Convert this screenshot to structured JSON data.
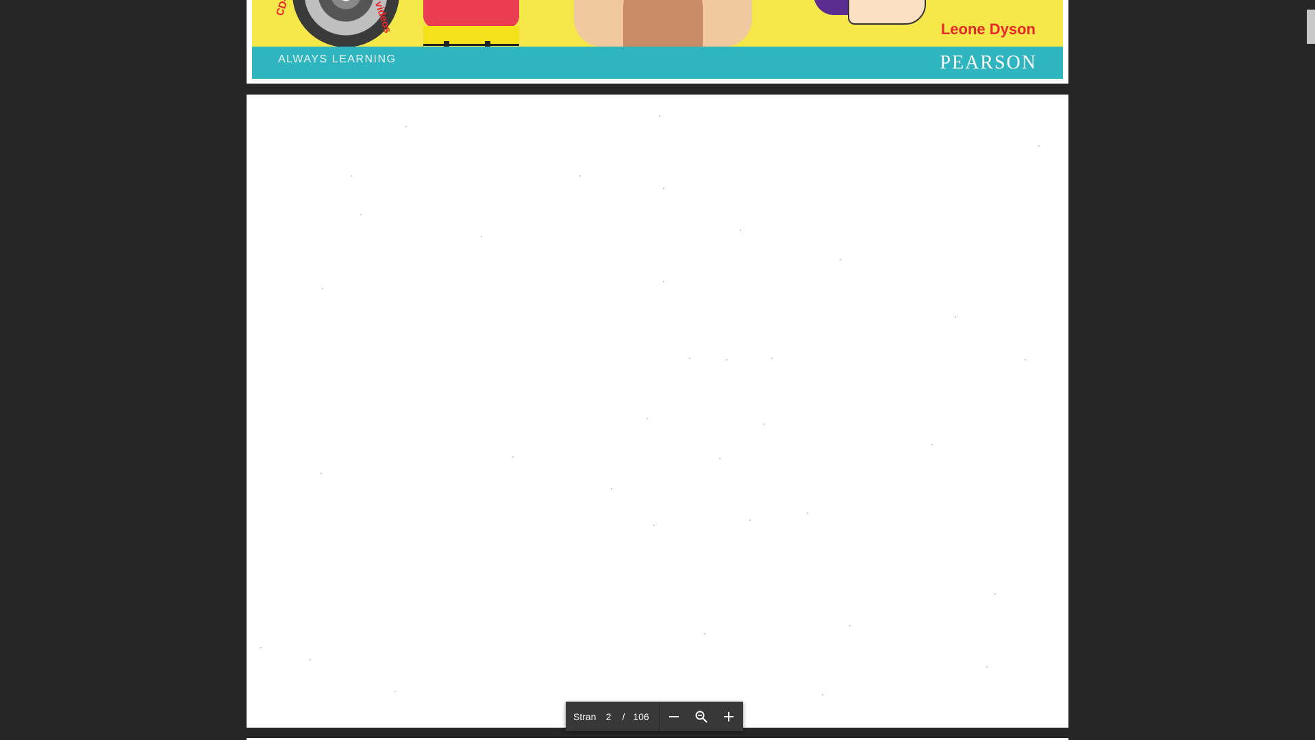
{
  "cover": {
    "band_left_text": "ALWAYS LEARNING",
    "band_right_text": "PEARSON",
    "author": "Leone Dyson",
    "cd_label_left": "CD-ROM",
    "cd_label_right": "videos",
    "colors": {
      "art_background": "#f7e84a",
      "band": "#2fb5bf",
      "author_text": "#e8262b"
    }
  },
  "toolbar": {
    "page_label": "Stran",
    "current_page": "2",
    "separator": "/",
    "total_pages": "106",
    "zoom_out_icon": "minus-icon",
    "zoom_reset_icon": "magnifier-icon",
    "zoom_in_icon": "plus-icon"
  },
  "colors": {
    "viewer_background": "#262626",
    "toolbar_background": "#383838",
    "page_background": "#ffffff"
  }
}
